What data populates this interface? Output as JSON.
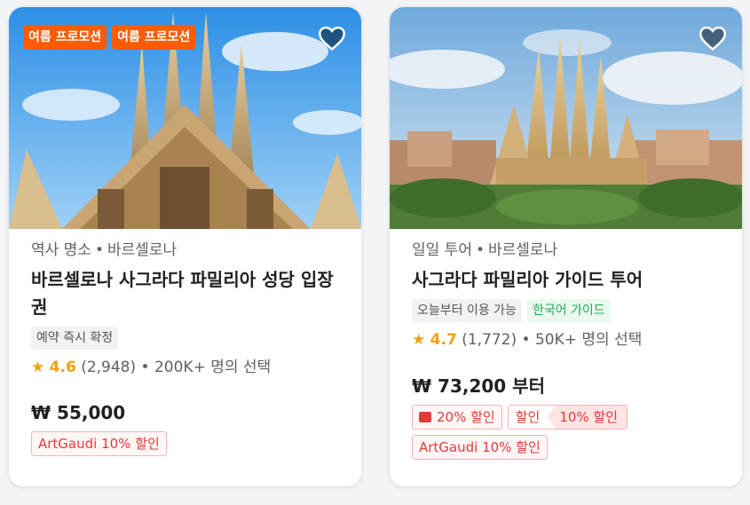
{
  "cards": [
    {
      "promos": [
        "여름 프로모션",
        "여름 프로모션"
      ],
      "category": "역사 명소",
      "city": "바르셀로나",
      "title": "바르셀로나 사그라다 파밀리아 성당 입장권",
      "chips": [
        "예약 즉시 확정"
      ],
      "rating": "4.6",
      "reviews": "(2,948)",
      "popularity": "200K+ 명의 선택",
      "price": "₩ 55,000",
      "deals": [
        "ArtGaudi 10% 할인"
      ]
    },
    {
      "category": "일일 투어",
      "city": "바르셀로나",
      "title": "사그라다 파밀리아 가이드 투어",
      "chips": [
        "오늘부터 이용 가능",
        "한국어 가이드"
      ],
      "rating": "4.7",
      "reviews": "(1,772)",
      "popularity": "50K+ 명의 선택",
      "price": "₩ 73,200 부터",
      "deals": {
        "coupon": "20% 할인",
        "split_left": "할인",
        "split_right": "10% 할인",
        "code": "ArtGaudi 10% 할인"
      }
    }
  ],
  "icons": {
    "heart": "heart-icon",
    "star": "star-icon",
    "coupon": "ticket-icon"
  }
}
